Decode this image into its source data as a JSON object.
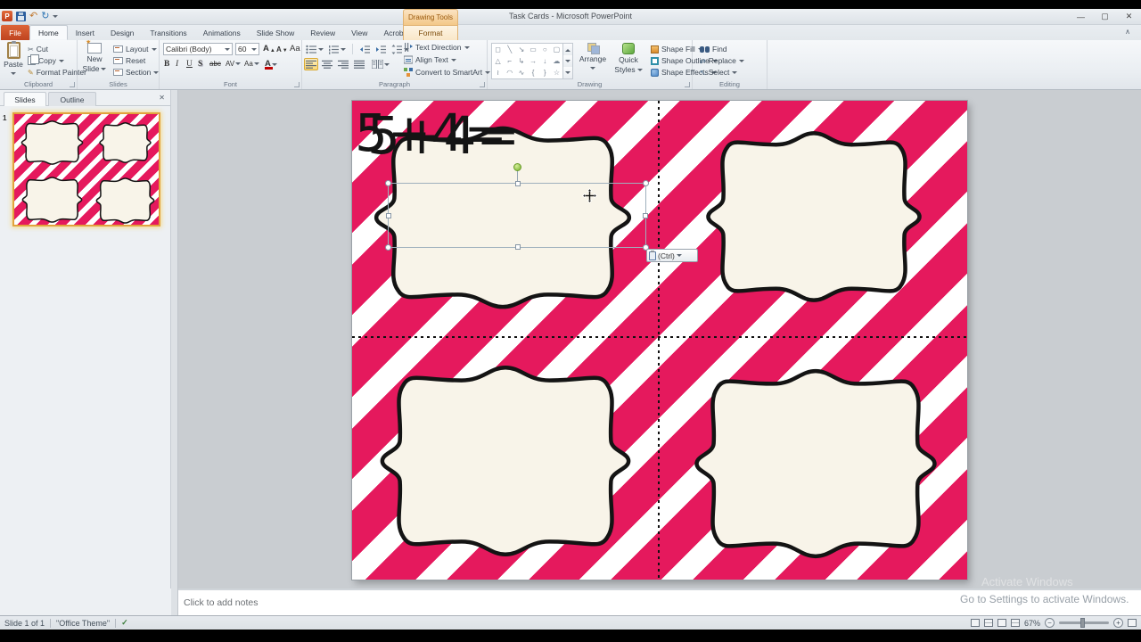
{
  "window": {
    "title": "Task Cards  -  Microsoft PowerPoint",
    "drawing_tools_header": "Drawing Tools"
  },
  "icons": {
    "powerpoint": "P",
    "undo": "↶",
    "redo": "↻",
    "minimize": "—",
    "maximize": "▢",
    "close": "✕",
    "panel_close": "✕",
    "ribbon_collapse": "∧",
    "cut": "✂",
    "format_painter": "✎",
    "replace": "⇄",
    "select": "↖",
    "spell_check": "✓"
  },
  "tabs": {
    "file": "File",
    "home": "Home",
    "insert": "Insert",
    "design": "Design",
    "transitions": "Transitions",
    "animations": "Animations",
    "slide_show": "Slide Show",
    "review": "Review",
    "view": "View",
    "acrobat": "Acrobat",
    "format": "Format"
  },
  "ribbon": {
    "clipboard": {
      "label": "Clipboard",
      "paste": "Paste",
      "cut": "Cut",
      "copy": "Copy",
      "format_painter": "Format Painter"
    },
    "slides": {
      "label": "Slides",
      "new_slide_line1": "New",
      "new_slide_line2": "Slide",
      "layout": "Layout",
      "reset": "Reset",
      "section": "Section"
    },
    "font": {
      "label": "Font",
      "name": "Calibri (Body)",
      "size": "60",
      "grow": "A",
      "shrink": "A",
      "clear": "Aa",
      "bold": "B",
      "italic": "I",
      "underline": "U",
      "shadow": "S",
      "strike": "abc",
      "spacing": "AV",
      "case": "Aa",
      "color": "A"
    },
    "paragraph": {
      "label": "Paragraph",
      "text_direction": "Text Direction",
      "align_text": "Align Text",
      "smartart": "Convert to SmartArt"
    },
    "drawing": {
      "label": "Drawing",
      "arrange": "Arrange",
      "quick": "Quick",
      "styles": "Styles",
      "fill": "Shape Fill",
      "outline": "Shape Outline",
      "effects": "Shape Effects",
      "shapes": [
        [
          "◻",
          "╲",
          "↘",
          "▭",
          "○",
          "▢"
        ],
        [
          "△",
          "⌐",
          "↳",
          "→",
          "↓",
          "☁"
        ],
        [
          "≀",
          "◠",
          "∿",
          "{",
          "}",
          "☆"
        ]
      ]
    },
    "editing": {
      "label": "Editing",
      "find": "Find",
      "replace": "Replace",
      "select": "Select"
    }
  },
  "panel": {
    "slides_tab": "Slides",
    "outline_tab": "Outline",
    "slide_number": "1"
  },
  "slide": {
    "equation": "5+4=",
    "paste_options": "(Ctrl)"
  },
  "notes": {
    "placeholder": "Click to add notes"
  },
  "status": {
    "slide_counter": "Slide 1 of 1",
    "theme": "\"Office Theme\"",
    "zoom_level": "67%"
  },
  "watermark": {
    "line1": "Activate Windows",
    "line2": "Go to Settings to activate Windows."
  },
  "colors": {
    "stripe_pink": "#e5195d",
    "card_cream": "#f8f4e9",
    "file_tab_orange": "#bf4420",
    "contextual_tab_accent": "#e0b272",
    "selection_handle_green": "#76b22c"
  }
}
